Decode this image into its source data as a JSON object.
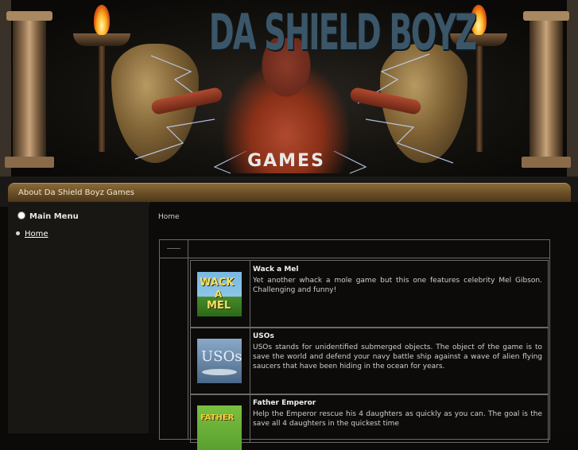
{
  "banner": {
    "title": "DA SHIELD BOYZ",
    "subtitle": "GAMES"
  },
  "navbar": {
    "label": "About Da Shield Boyz Games"
  },
  "sidebar": {
    "menu_title": "Main Menu",
    "items": [
      {
        "label": "Home"
      }
    ]
  },
  "main": {
    "breadcrumb": "Home",
    "games": [
      {
        "thumb_text": [
          "WACK",
          "A",
          "MEL"
        ],
        "title": "Wack a Mel",
        "description": "Yet another whack a mole game but this one features celebrity Mel Gibson. Challenging and funny!"
      },
      {
        "thumb_text": [
          "USOs"
        ],
        "title": "USOs",
        "description": "USOs stands for unidentified submerged objects. The object of the game is to save the world and defend your navy battle ship against a wave of alien flying saucers that have been hiding in the ocean for years."
      },
      {
        "thumb_text": [
          "FATHER"
        ],
        "title": "Father Emperor",
        "description": "Help the Emperor rescue his 4 daughters as quickly as you can. The goal is the save all 4 daughters in the quickest time"
      }
    ]
  }
}
